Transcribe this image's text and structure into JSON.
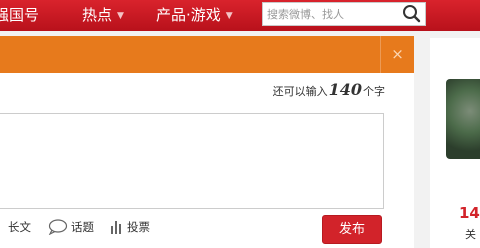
{
  "nav": {
    "partial_item": "强国号",
    "hot": "热点",
    "products": "产品·游戏",
    "search_placeholder": "搜索微博、找人"
  },
  "dialog": {
    "close_symbol": "×",
    "counter_prefix": "还可以输入",
    "counter_value": "140",
    "counter_suffix": "个字",
    "tools": {
      "longtext": "长文",
      "topic": "话题",
      "poll": "投票"
    },
    "publish_label": "发布"
  },
  "sidebar": {
    "count": "14",
    "label": "关"
  },
  "colors": {
    "nav_red": "#c8161d",
    "dialog_orange": "#e77a1c",
    "publish_red": "#d2232a"
  },
  "icons": [
    "search-icon",
    "chevron-down-icon",
    "speech-bubble-icon",
    "bar-chart-icon",
    "close-icon"
  ]
}
